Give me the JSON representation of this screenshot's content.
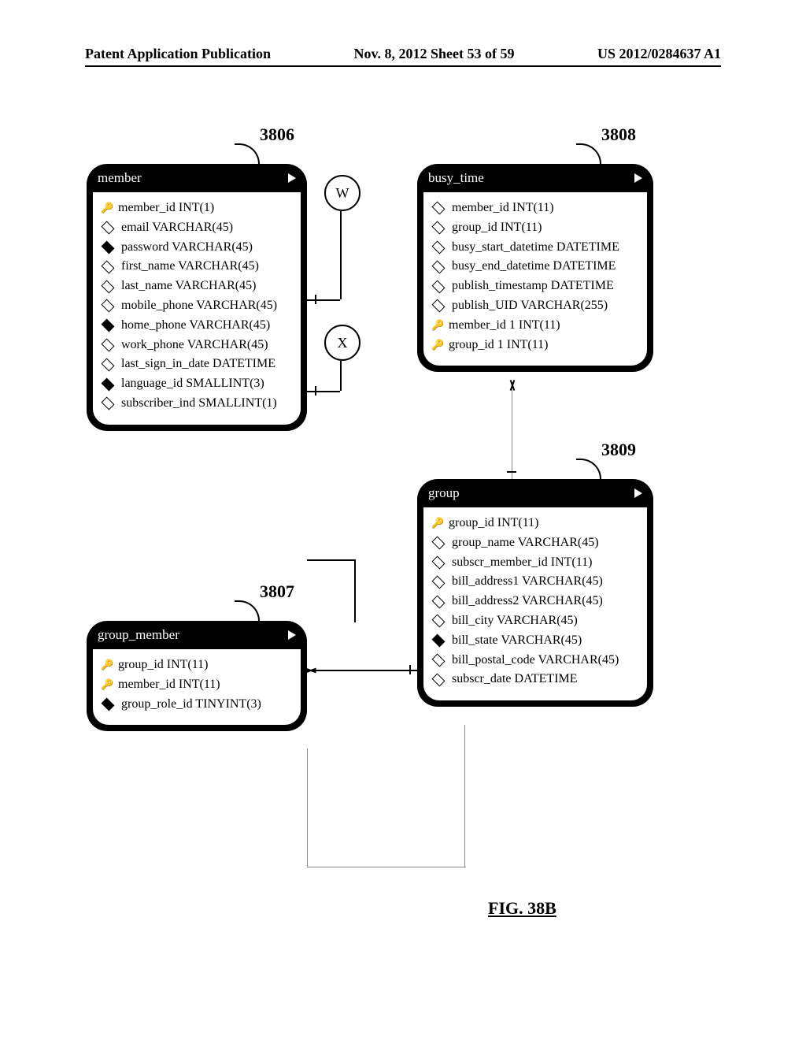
{
  "header": {
    "left": "Patent Application Publication",
    "center": "Nov. 8, 2012  Sheet 53 of 59",
    "right": "US 2012/0284637 A1"
  },
  "figure_label": "FIG. 38B",
  "refs": {
    "r3806": "3806",
    "r3807": "3807",
    "r3808": "3808",
    "r3809": "3809"
  },
  "connectors": {
    "w": "W",
    "x": "X"
  },
  "icons": {
    "key_glyph": "🔑"
  },
  "entities": {
    "member": {
      "title": "member",
      "fields": [
        {
          "icon": "key",
          "text": "member_id INT(1)"
        },
        {
          "icon": "dia_open",
          "text": "email VARCHAR(45)"
        },
        {
          "icon": "dia_solid",
          "text": "password VARCHAR(45)"
        },
        {
          "icon": "dia_open",
          "text": "first_name VARCHAR(45)"
        },
        {
          "icon": "dia_open",
          "text": "last_name VARCHAR(45)"
        },
        {
          "icon": "dia_open",
          "text": "mobile_phone VARCHAR(45)"
        },
        {
          "icon": "dia_solid",
          "text": "home_phone VARCHAR(45)"
        },
        {
          "icon": "dia_open",
          "text": "work_phone VARCHAR(45)"
        },
        {
          "icon": "dia_open",
          "text": "last_sign_in_date DATETIME"
        },
        {
          "icon": "dia_solid",
          "text": "language_id SMALLINT(3)"
        },
        {
          "icon": "dia_open",
          "text": "subscriber_ind SMALLINT(1)"
        }
      ]
    },
    "group_member": {
      "title": "group_member",
      "fields": [
        {
          "icon": "key",
          "text": "group_id INT(11)"
        },
        {
          "icon": "key",
          "text": "member_id INT(11)"
        },
        {
          "icon": "dia_solid",
          "text": "group_role_id TINYINT(3)"
        }
      ]
    },
    "busy_time": {
      "title": "busy_time",
      "fields": [
        {
          "icon": "dia_open",
          "text": "member_id INT(11)"
        },
        {
          "icon": "dia_open",
          "text": "group_id INT(11)"
        },
        {
          "icon": "dia_open",
          "text": "busy_start_datetime DATETIME"
        },
        {
          "icon": "dia_open",
          "text": "busy_end_datetime DATETIME"
        },
        {
          "icon": "dia_open",
          "text": "publish_timestamp DATETIME"
        },
        {
          "icon": "dia_open",
          "text": "publish_UID VARCHAR(255)"
        },
        {
          "icon": "key",
          "text": "member_id 1 INT(11)"
        },
        {
          "icon": "key",
          "text": "group_id 1 INT(11)"
        }
      ]
    },
    "group": {
      "title": "group",
      "fields": [
        {
          "icon": "key",
          "text": "group_id INT(11)"
        },
        {
          "icon": "dia_open",
          "text": "group_name VARCHAR(45)"
        },
        {
          "icon": "dia_open",
          "text": "subscr_member_id INT(11)"
        },
        {
          "icon": "dia_open",
          "text": "bill_address1 VARCHAR(45)"
        },
        {
          "icon": "dia_open",
          "text": "bill_address2 VARCHAR(45)"
        },
        {
          "icon": "dia_open",
          "text": "bill_city VARCHAR(45)"
        },
        {
          "icon": "dia_solid",
          "text": "bill_state VARCHAR(45)"
        },
        {
          "icon": "dia_open",
          "text": "bill_postal_code VARCHAR(45)"
        },
        {
          "icon": "dia_open",
          "text": "subscr_date DATETIME"
        }
      ]
    }
  }
}
